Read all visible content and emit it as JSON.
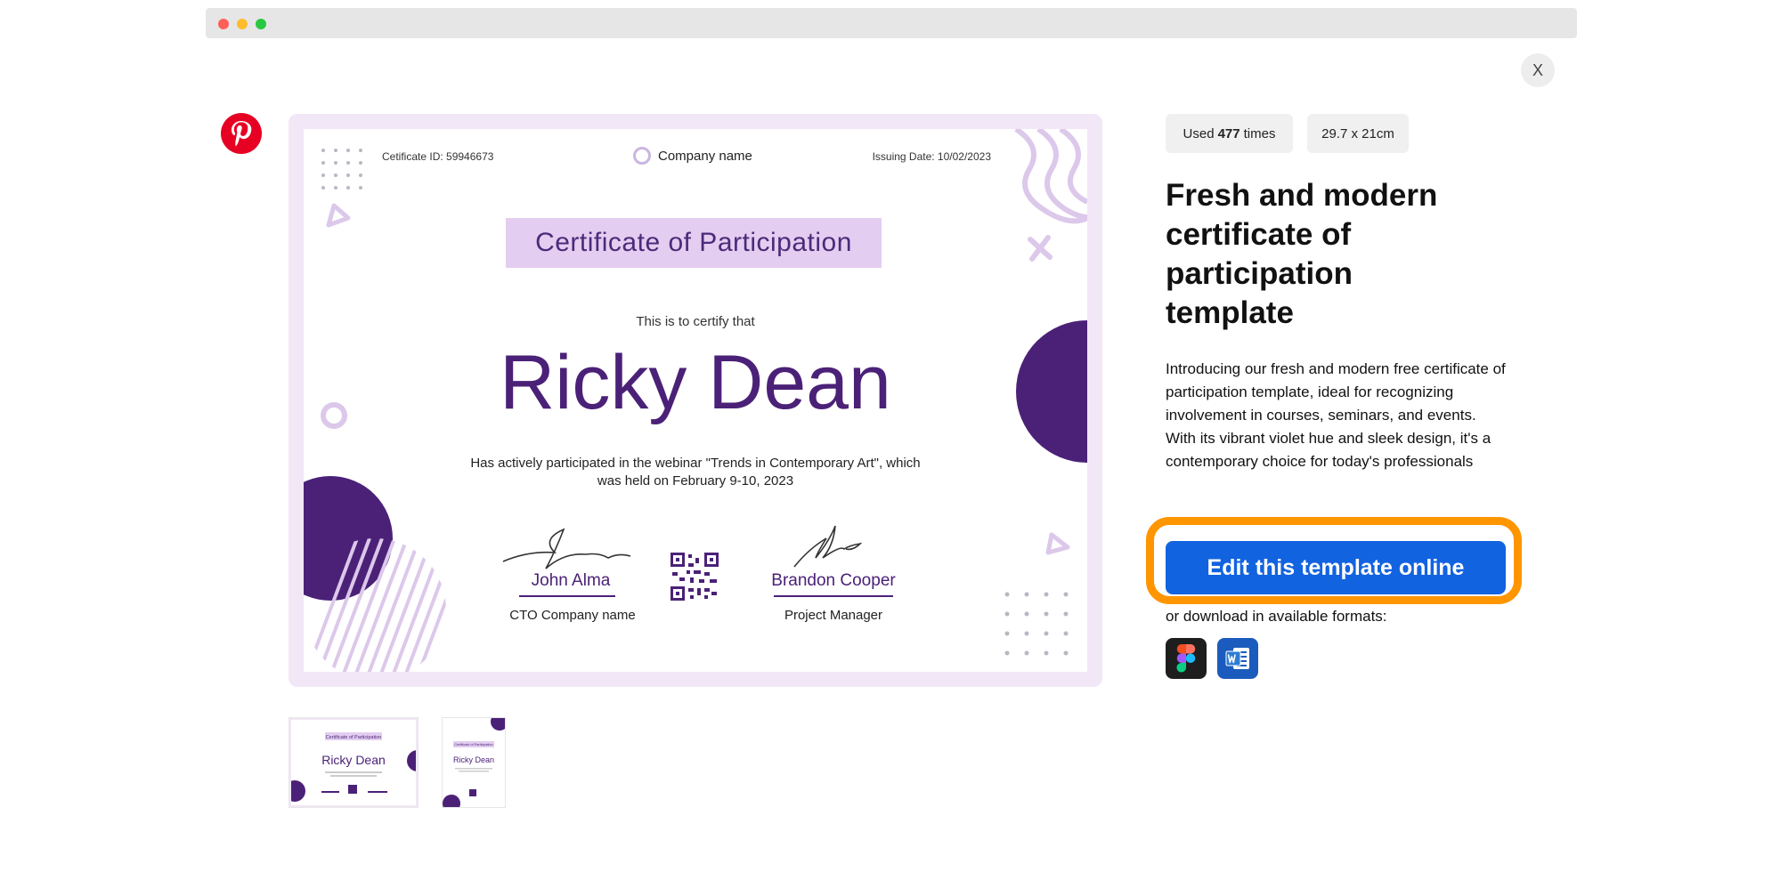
{
  "window": {
    "close_label": "X"
  },
  "certificate": {
    "certificate_id": "Cetificate ID: 59946673",
    "company_name": "Company name",
    "issuing_date": "Issuing Date: 10/02/2023",
    "title": "Certificate of Participation",
    "certify_text": "This is to certify that",
    "recipient": "Ricky Dean",
    "description": "Has actively participated in the webinar \"Trends in Contemporary Art\", which was held on February 9-10, 2023",
    "signer1_name": "John Alma",
    "signer1_role": "CTO Company name",
    "signer2_name": "Brandon Cooper",
    "signer2_role": "Project Manager",
    "accent_color": "#4b2178",
    "pale_color": "#e3cdf0"
  },
  "thumbnails": {
    "thumb1": {
      "title": "Certificate of Participation",
      "recipient": "Ricky Dean"
    },
    "thumb2": {
      "title": "Certificate of Participation",
      "recipient": "Ricky Dean"
    }
  },
  "info": {
    "usage_prefix": "Used",
    "usage_count": "477",
    "usage_suffix": "times",
    "size": "29.7 x 21cm",
    "title": "Fresh and modern certificate of participation template",
    "description": "Introducing our fresh and modern free certificate of participation template, ideal for recognizing involvement in courses, seminars, and events. With its vibrant violet hue and sleek design, it's a contemporary choice for today's professionals",
    "cta_label": "Edit this template online",
    "download_text": "or download in available formats:",
    "formats": [
      "figma-icon",
      "word-icon"
    ],
    "cta_color": "#1263e0",
    "highlight_color": "#ff9500"
  }
}
